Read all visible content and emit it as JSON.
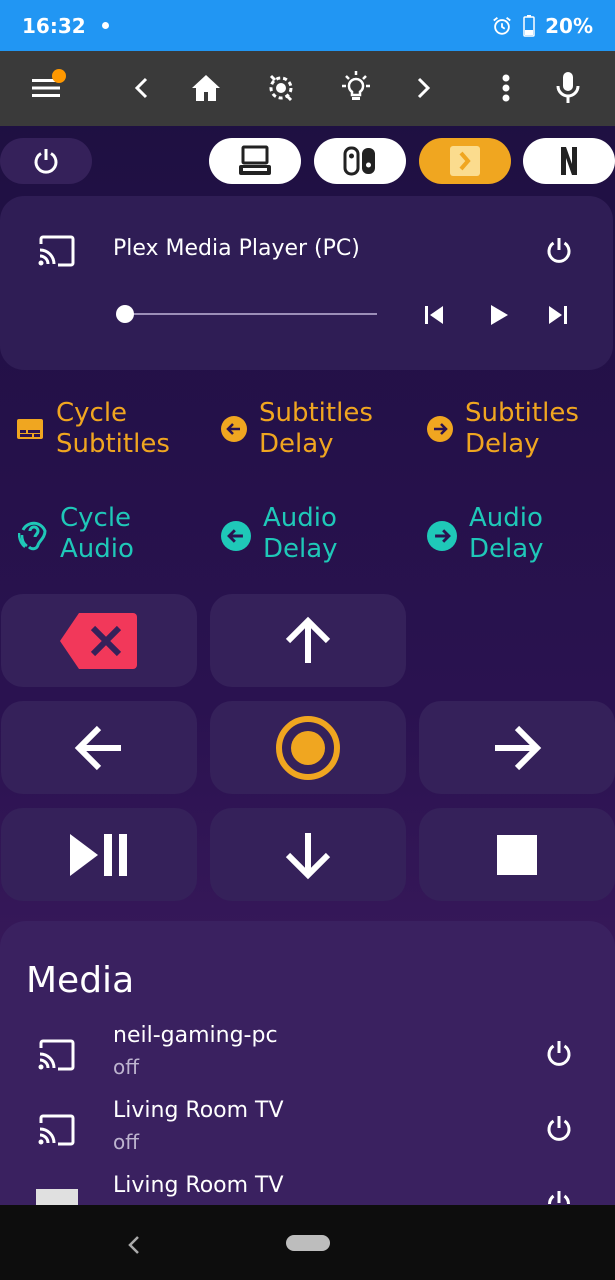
{
  "status_bar": {
    "time": "16:32",
    "battery": "20%"
  },
  "player": {
    "name": "Plex Media Player (PC)",
    "progress": 0.0
  },
  "shortcuts": [
    {
      "label_line1": "Cycle",
      "label_line2": "Subtitles",
      "icon": "subtitles-icon",
      "color": "#f0a620"
    },
    {
      "label_line1": "Subtitles",
      "label_line2": "Delay",
      "icon": "arrow-left-circle-icon",
      "color": "#f0a620"
    },
    {
      "label_line1": "Subtitles",
      "label_line2": "Delay",
      "icon": "arrow-right-circle-icon",
      "color": "#f0a620"
    },
    {
      "label_line1": "Cycle",
      "label_line2": "Audio",
      "icon": "ear-icon",
      "color": "#1fc8b8"
    },
    {
      "label_line1": "Audio",
      "label_line2": "Delay",
      "icon": "arrow-left-circle-icon",
      "color": "#1fc8b8"
    },
    {
      "label_line1": "Audio",
      "label_line2": "Delay",
      "icon": "arrow-right-circle-icon",
      "color": "#1fc8b8"
    }
  ],
  "media": {
    "heading": "Media",
    "items": [
      {
        "name": "neil-gaming-pc",
        "state": "off"
      },
      {
        "name": "Living Room TV",
        "state": "off"
      },
      {
        "name": "Living Room TV",
        "state": ""
      }
    ]
  },
  "colors": {
    "accent_orange": "#f0a620",
    "accent_teal": "#1fc8b8",
    "back_red": "#f2385a"
  }
}
